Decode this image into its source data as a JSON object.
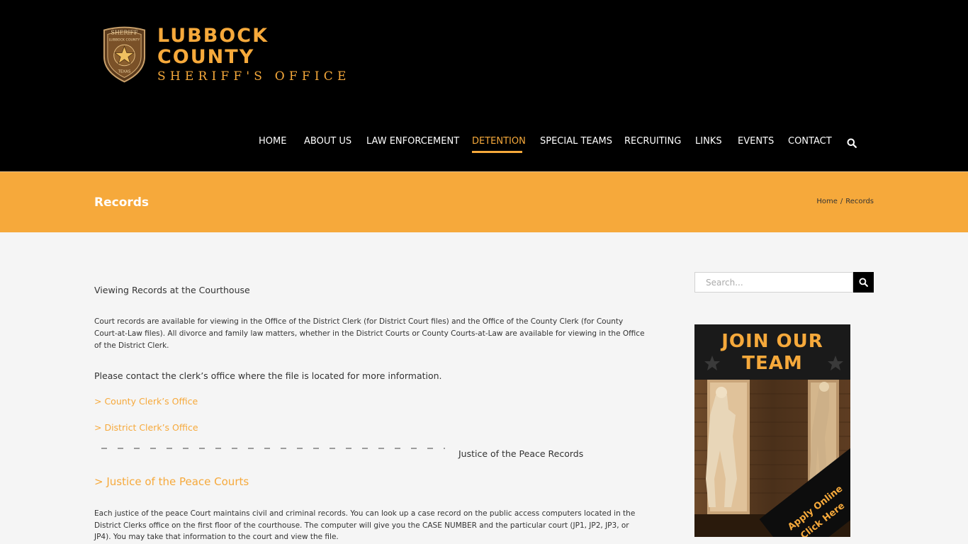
{
  "header": {
    "logo": {
      "badge_text_top": "SHERIFF",
      "badge_text_mid": "LUBBOCK COUNTY",
      "badge_text_bottom": "TEXAS",
      "title": "LUBBOCK COUNTY",
      "subtitle": "SHERIFF'S OFFICE"
    },
    "nav": [
      {
        "label": "HOME"
      },
      {
        "label": "ABOUT US"
      },
      {
        "label": "LAW ENFORCEMENT"
      },
      {
        "label": "DETENTION"
      },
      {
        "label": "SPECIAL TEAMS"
      },
      {
        "label": "RECRUITING"
      },
      {
        "label": "LINKS"
      },
      {
        "label": "EVENTS"
      },
      {
        "label": "CONTACT"
      }
    ],
    "active_nav": "DETENTION"
  },
  "titlebar": {
    "title": "Records",
    "breadcrumb": [
      "Home",
      "Records"
    ],
    "breadcrumb_sep": "/"
  },
  "content": {
    "heading": "Viewing Records at the Courthouse",
    "paragraph1": "Court records are available for viewing in the Office of the District Clerk (for District Court files) and the Office of the County Clerk (for County Court-at-Law files).  All divorce and family law matters, whether in the District Courts or County Courts-at-Law are available for viewing in the Office of the District Clerk.",
    "contact_text": "Please contact the clerk’s office where the file is located for more information.",
    "links": {
      "county_clerk": "> County Clerk’s Office",
      "district_clerk": "> District Clerk’s Office",
      "jp_courts": "> Justice of the Peace Courts"
    },
    "jp_heading": "Justice of the Peace Records",
    "paragraph2": "Each justice of the peace Court maintains civil and criminal records. You can look up a case record on the public access computers located in the District Clerks office on the first floor of the courthouse. The computer will give you the CASE NUMBER and the particular court (JP1, JP2, JP3, or JP4). You may take that information to the court and view the file."
  },
  "sidebar": {
    "search_placeholder": "Search...",
    "ad": {
      "line1": "JOIN OUR",
      "line2": "TEAM",
      "cta1": "Apply Online",
      "cta2": "Click Here"
    }
  },
  "colors": {
    "accent": "#f6a93b",
    "header_bg": "#000000",
    "page_bg": "#f5f5f5"
  }
}
